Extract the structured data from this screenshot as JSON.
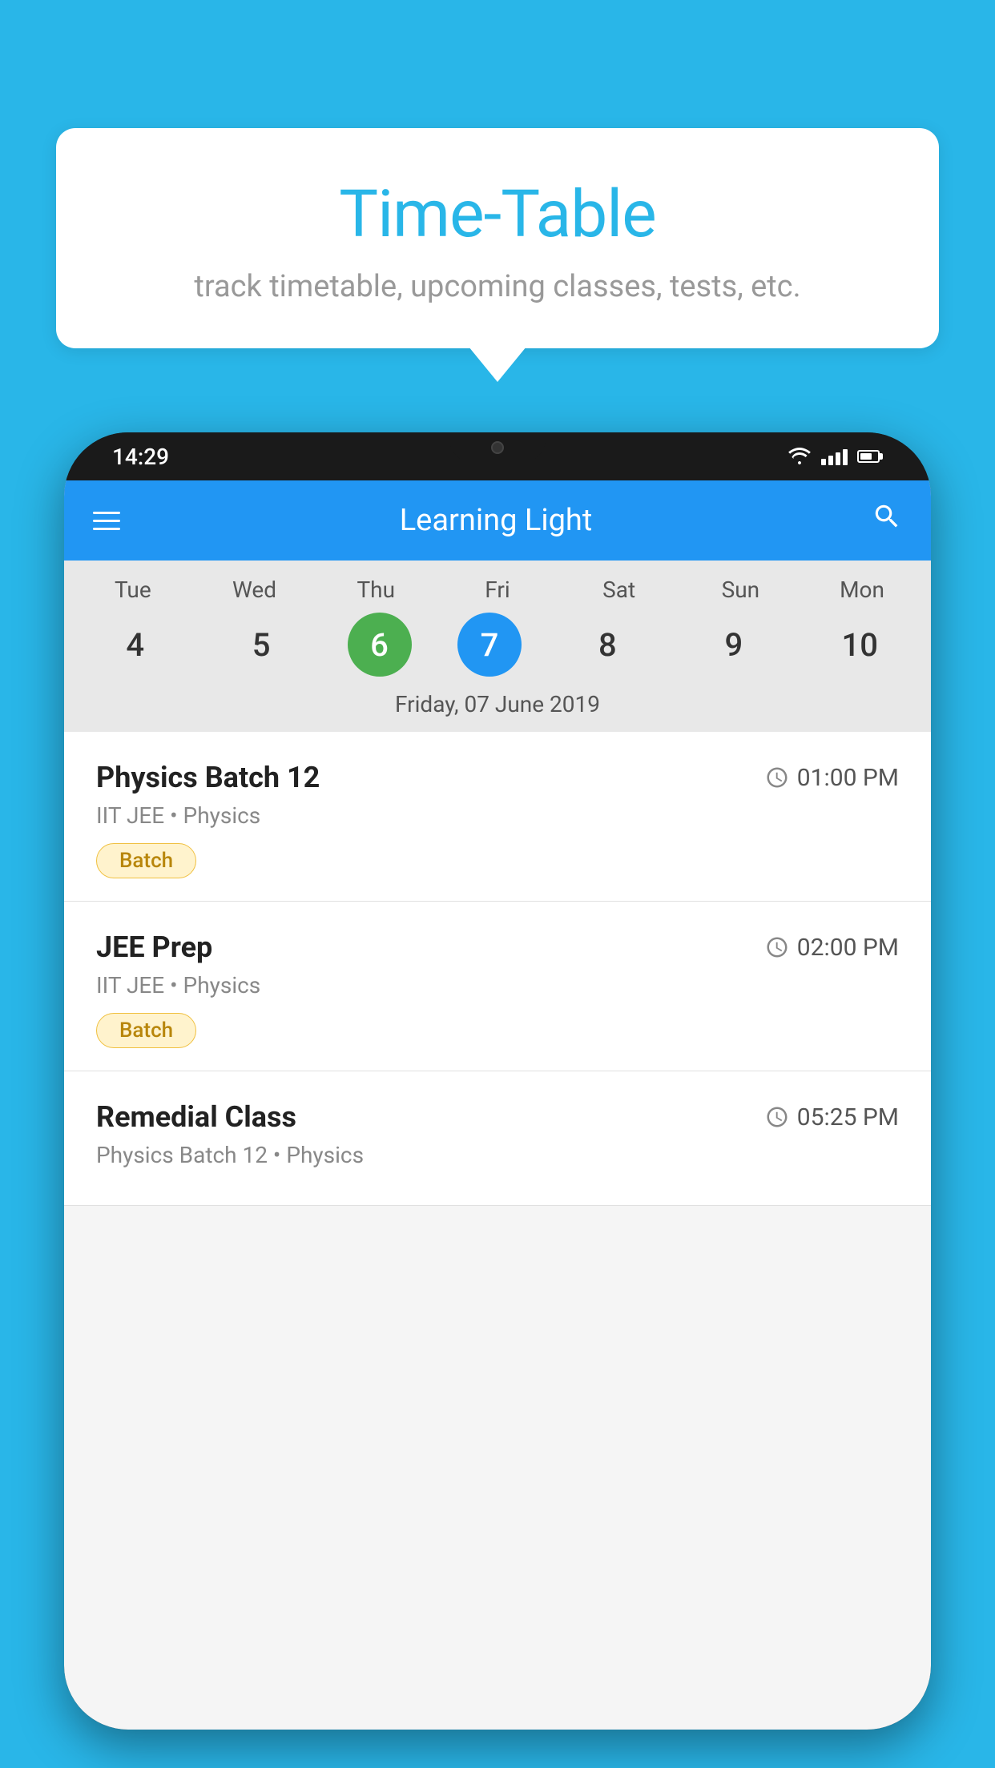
{
  "background_color": "#29B6E8",
  "speech_bubble": {
    "title": "Time-Table",
    "subtitle": "track timetable, upcoming classes, tests, etc."
  },
  "phone": {
    "status_bar": {
      "time": "14:29"
    },
    "header": {
      "app_name": "Learning Light"
    },
    "calendar": {
      "days": [
        {
          "label": "Tue",
          "number": "4"
        },
        {
          "label": "Wed",
          "number": "5"
        },
        {
          "label": "Thu",
          "number": "6",
          "state": "today"
        },
        {
          "label": "Fri",
          "number": "7",
          "state": "selected"
        },
        {
          "label": "Sat",
          "number": "8"
        },
        {
          "label": "Sun",
          "number": "9"
        },
        {
          "label": "Mon",
          "number": "10"
        }
      ],
      "selected_date": "Friday, 07 June 2019"
    },
    "schedule": [
      {
        "name": "Physics Batch 12",
        "time": "01:00 PM",
        "subject_line": "IIT JEE • Physics",
        "tag": "Batch"
      },
      {
        "name": "JEE Prep",
        "time": "02:00 PM",
        "subject_line": "IIT JEE • Physics",
        "tag": "Batch"
      },
      {
        "name": "Remedial Class",
        "time": "05:25 PM",
        "subject_line": "Physics Batch 12 • Physics",
        "tag": null
      }
    ]
  }
}
